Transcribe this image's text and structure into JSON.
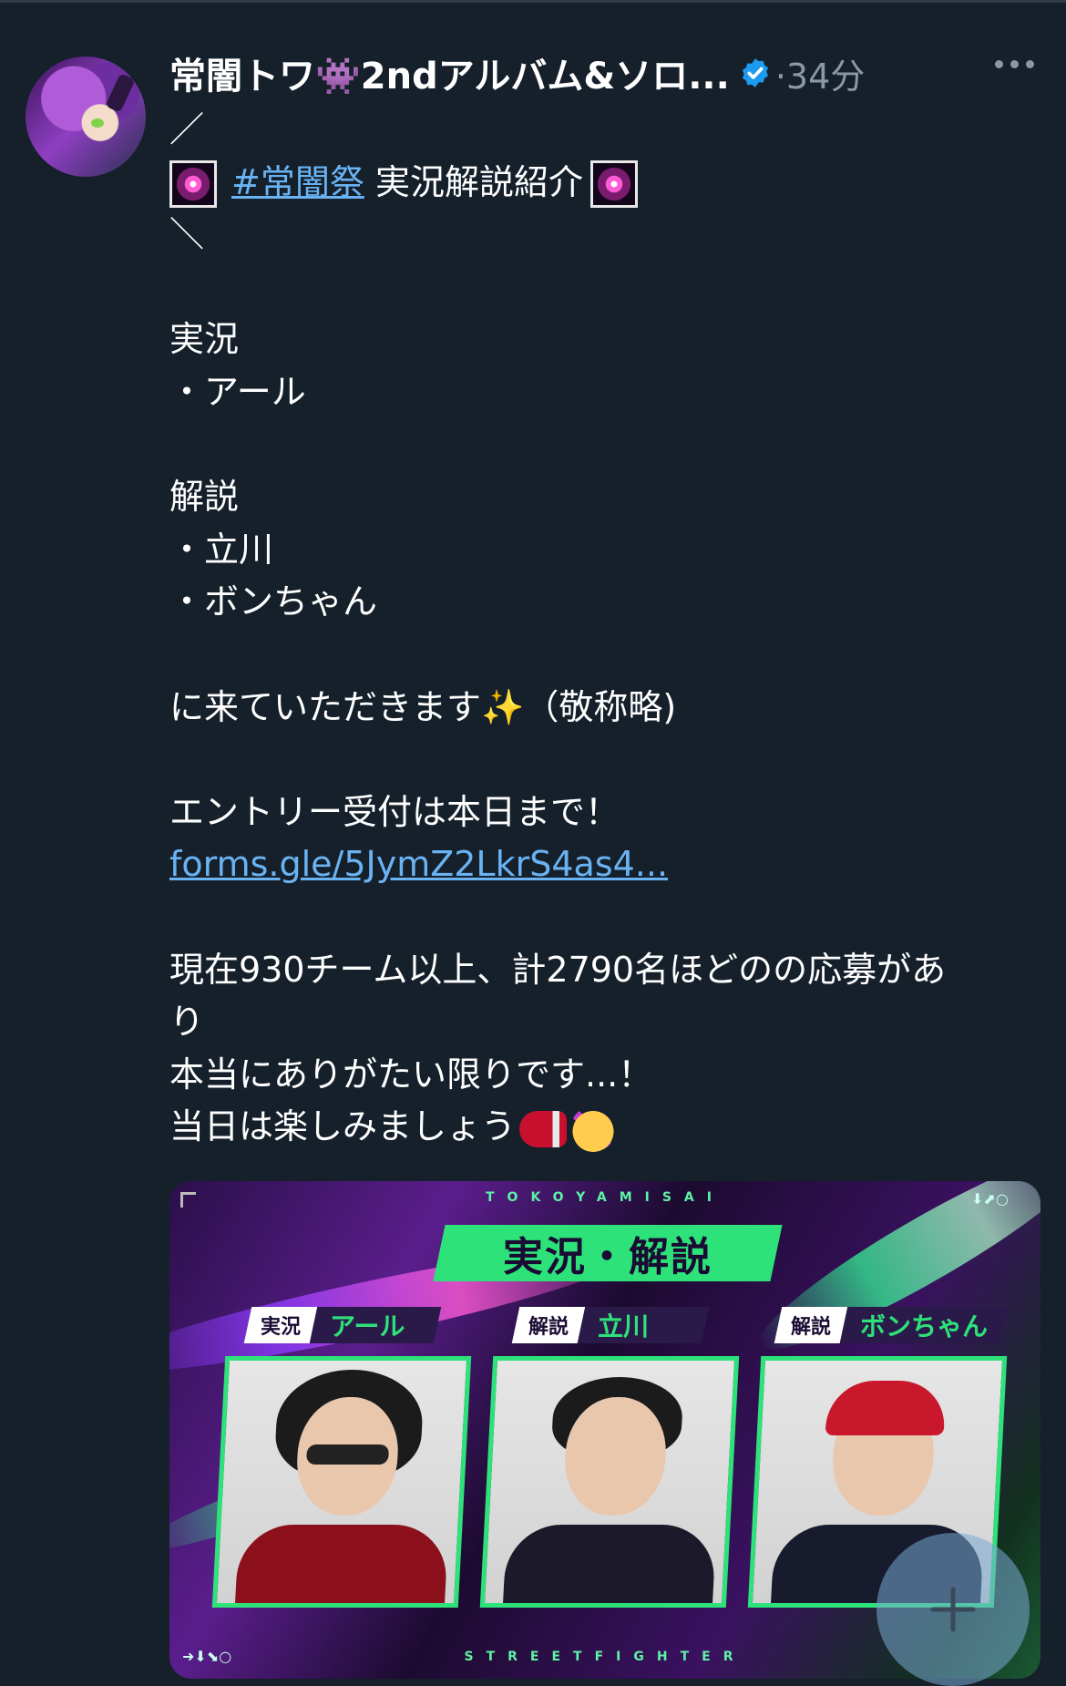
{
  "post": {
    "author_name": "常闇トワ👾2ndアルバム&ソロ...",
    "verified_icon": "verified-badge-icon",
    "meta": "·34分",
    "more_icon": "more-horizontal-icon",
    "lines": {
      "deco_top": "／",
      "hashtag": "#常闇祭",
      "headline_rest": "実況解説紹介",
      "deco_bottom": "＼",
      "section1_title": "実況",
      "section1_item1": "・アール",
      "section2_title": "解説",
      "section2_item1": "・立川",
      "section2_item2": "・ボンちゃん",
      "thanks_a": "に来ていただきます",
      "thanks_sparkle": "✨",
      "thanks_b": "（敬称略)",
      "entry": "エントリー受付は本日まで！",
      "link": "forms.gle/5JymZ2LkrS4as4...",
      "count_line1": "現在930チーム以上、計2790名ほどのの応募があ",
      "count_line2": "り",
      "grateful": "本当にありがたい限りです...！",
      "enjoy": "当日は楽しみましょう"
    },
    "emoji_icons": [
      "fireworks-icon",
      "sparkles-icon",
      "boxing-glove-icon",
      "party-face-icon"
    ]
  },
  "media": {
    "top_word": "TOKOYAMISAI",
    "bottom_word": "STREETFIGHTER",
    "banner_title": "実況・解説",
    "casters": [
      {
        "role": "実況",
        "name": "アール"
      },
      {
        "role": "解説",
        "name": "立川"
      },
      {
        "role": "解説",
        "name": "ボンちゃん"
      }
    ]
  },
  "fab": {
    "icon": "plus-compose-icon"
  },
  "colors": {
    "background": "#15202b",
    "link": "#6ab3f3",
    "muted": "#8b98a5",
    "accent_green": "#2ee27a"
  }
}
